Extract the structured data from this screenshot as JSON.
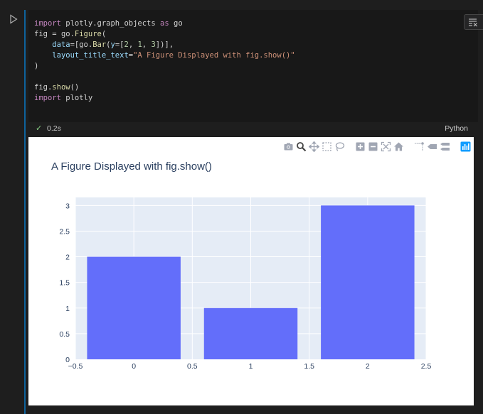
{
  "cell": {
    "code_lines": [
      [
        {
          "t": "import",
          "c": "kw"
        },
        {
          "t": " plotly.graph_objects "
        },
        {
          "t": "as",
          "c": "kw"
        },
        {
          "t": " go"
        }
      ],
      [
        {
          "t": "fig"
        },
        {
          "t": " = "
        },
        {
          "t": "go."
        },
        {
          "t": "Figure",
          "c": "fn"
        },
        {
          "t": "("
        }
      ],
      [
        {
          "t": "    "
        },
        {
          "t": "data",
          "c": "attr"
        },
        {
          "t": "=[go."
        },
        {
          "t": "Bar",
          "c": "fn"
        },
        {
          "t": "("
        },
        {
          "t": "y",
          "c": "attr"
        },
        {
          "t": "=["
        },
        {
          "t": "2",
          "c": "num"
        },
        {
          "t": ", "
        },
        {
          "t": "1",
          "c": "num"
        },
        {
          "t": ", "
        },
        {
          "t": "3",
          "c": "num"
        },
        {
          "t": "])],"
        }
      ],
      [
        {
          "t": "    "
        },
        {
          "t": "layout_title_text",
          "c": "attr"
        },
        {
          "t": "="
        },
        {
          "t": "\"A Figure Displayed with fig.show()\"",
          "c": "str"
        }
      ],
      [
        {
          "t": ")"
        }
      ],
      [
        {
          "t": ""
        }
      ],
      [
        {
          "t": "fig."
        },
        {
          "t": "show",
          "c": "fn"
        },
        {
          "t": "()"
        }
      ],
      [
        {
          "t": "import",
          "c": "kw"
        },
        {
          "t": " plotly"
        }
      ]
    ],
    "exec_check": "✓",
    "exec_time": "0.2s",
    "language": "Python",
    "toolbar": [
      "clear-output-icon",
      "delete-cell-icon"
    ]
  },
  "modebar": {
    "buttons": [
      "camera-icon",
      "zoom-icon",
      "pan-icon",
      "box-select-icon",
      "lasso-icon",
      "zoom-in-icon",
      "zoom-out-icon",
      "autoscale-icon",
      "reset-axes-icon",
      "spike-lines-icon",
      "hover-closest-icon",
      "hover-compare-icon",
      "plotly-logo-icon"
    ],
    "logo_color": "#119dff"
  },
  "chart_data": {
    "type": "bar",
    "title": "A Figure Displayed with fig.show()",
    "x": [
      0,
      1,
      2
    ],
    "values": [
      2,
      1,
      3
    ],
    "xlim": [
      -0.5,
      2.5
    ],
    "ylim": [
      0,
      3.157
    ],
    "xticks": [
      "−0.5",
      "0",
      "0.5",
      "1",
      "1.5",
      "2",
      "2.5"
    ],
    "yticks": [
      "0",
      "0.5",
      "1",
      "1.5",
      "2",
      "2.5",
      "3"
    ],
    "grid": true,
    "bar_color": "#636efa",
    "plot_bg": "#e5ecf6",
    "xlabel": "",
    "ylabel": ""
  }
}
